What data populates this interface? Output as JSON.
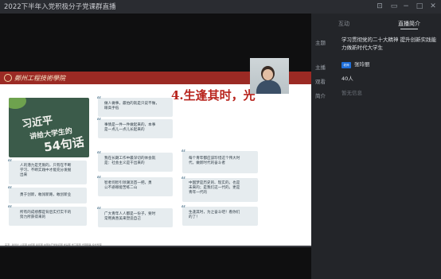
{
  "window": {
    "title": "2022下半年入党积极分子党课群直播"
  },
  "titlebar_icons": [
    "pin-icon",
    "window-icon",
    "minimize-icon",
    "maximize-icon",
    "close-icon"
  ],
  "slide": {
    "school_name": "鄭州工程技術學院",
    "heading": "4.生逢其时，光",
    "board": {
      "line1": "习近平",
      "line2": "讲给大学生的",
      "line3": "54句话"
    },
    "cards": [
      {
        "text": [
          "做人做事，最怕的就是只说不做，",
          "眼高手低"
        ]
      },
      {
        "text": [
          "事情是一件一件做起来的，本事",
          "是一点儿一点儿长起来的"
        ]
      },
      {
        "text": [
          "人的潜力是无限的，只有在不断",
          "学习、不断实践中才能充分发掘",
          "出来"
        ]
      },
      {
        "text": [
          "我在长期工作中最深切的体会就",
          "是：社会主义是干出来的"
        ]
      },
      {
        "text": [
          "每个青年都应该珍惜这个伟大时",
          "代，做新时代的奋斗者"
        ]
      },
      {
        "text": [
          "勇于创新，敢闯新路，敢创新业"
        ]
      },
      {
        "text": [
          "智者何智引领潮流首一把，勇",
          "公不惑哪能苦练二山"
        ]
      },
      {
        "text": [
          "中国梦是历史的、现实的，也是",
          "未来的；是我们这一代的，更是",
          "青年一代的"
        ]
      },
      {
        "text": [
          "所有的成绩都是背后实打实干的",
          "努力所获得来的"
        ]
      },
      {
        "text": [
          "广大青年人人都是一份子，要时",
          "常用真善美来塑造自己"
        ]
      },
      {
        "text": [
          "生逢其时，为之奋斗吧！看你们",
          "的了！"
        ]
      }
    ],
    "footer_text": "来源：新华社 人民网 央视网 青年网 中国共产党新闻网 求是网 学习强国 光明网等 综合整理"
  },
  "panel": {
    "tabs": [
      "互动",
      "直播简介"
    ],
    "active_tab": "直播简介",
    "rows": {
      "topic_label": "主题",
      "topic_value": "学习贯彻党的二十大精神 提升创新实践能力做新时代大学生",
      "host_label": "主播",
      "host_badge": "老师",
      "host_value": "张玲丽",
      "viewers_label": "观看",
      "viewers_value": "40人",
      "intro_label": "简介",
      "intro_value": "暂无信息"
    }
  },
  "colors": {
    "accent_red": "#b8241d",
    "header_red": "#9b2a24",
    "panel_bg": "#232529",
    "badge_blue": "#1e6fd9"
  }
}
